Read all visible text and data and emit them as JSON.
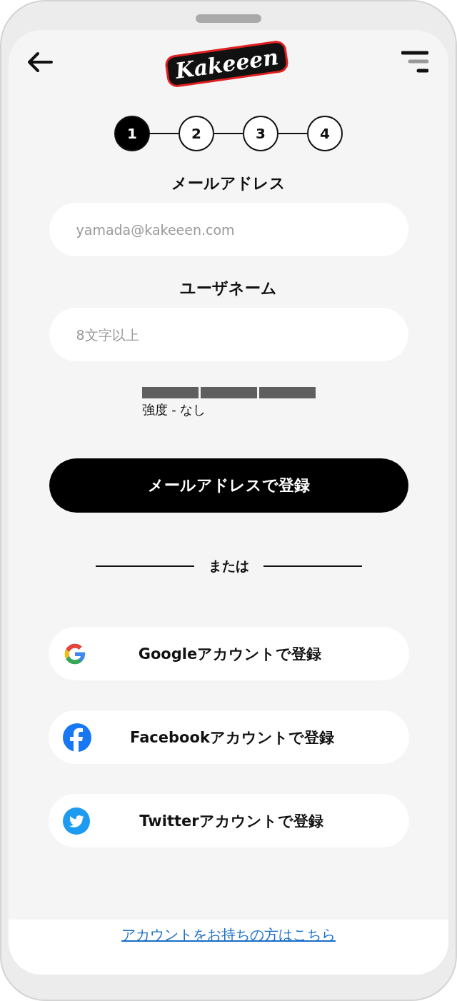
{
  "header": {
    "logo": "Kakeeen"
  },
  "steps": [
    {
      "label": "1",
      "selected": true
    },
    {
      "label": "2",
      "selected": false
    },
    {
      "label": "3",
      "selected": false
    },
    {
      "label": "4",
      "selected": false
    }
  ],
  "fields": [
    {
      "label": "メールアドレス",
      "placeholder": "yamada@kakeeen.com"
    },
    {
      "label": "ユーザネーム",
      "placeholder": "8文字以上"
    }
  ],
  "strength": {
    "label": "強度 - なし"
  },
  "submit_button": "メールアドレスで登録",
  "divider": "または",
  "social_buttons": [
    {
      "kind": "google",
      "label": "Googleアカウントで登録"
    },
    {
      "kind": "facebook",
      "label": "Facebookアカウントで登録"
    },
    {
      "kind": "twitter",
      "label": "Twitterアカウントで登録"
    }
  ],
  "footer_link": "アカウントをお持ちの方はこちら"
}
